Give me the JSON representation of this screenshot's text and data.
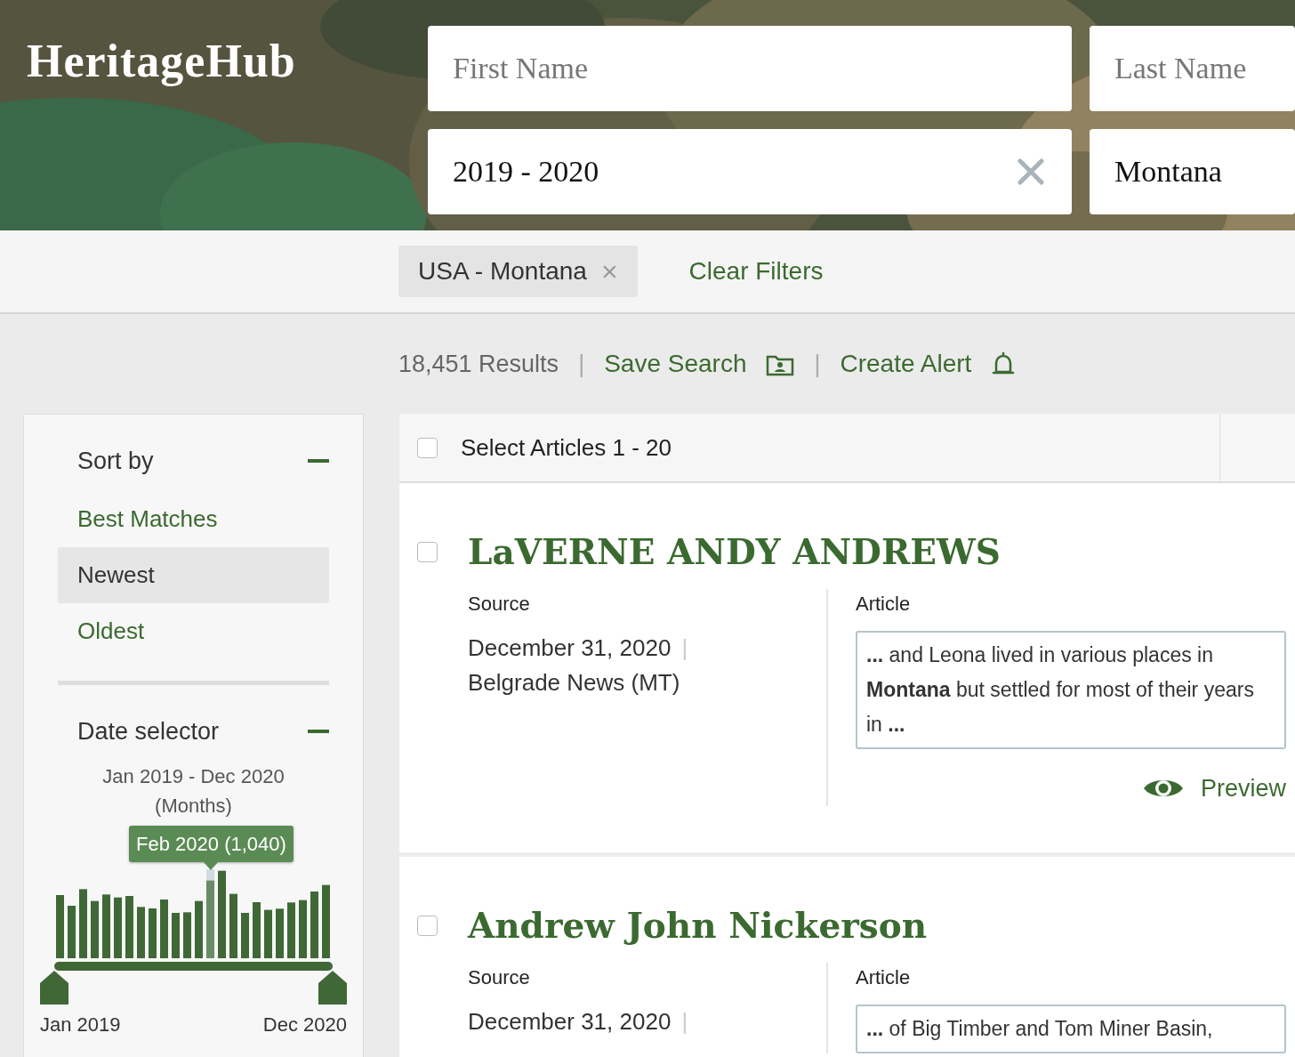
{
  "logo": "HeritageHub",
  "search_fields": [
    {
      "placeholder": "First Name"
    },
    {
      "placeholder": "Last Name"
    },
    {
      "value": "2019 - 2020",
      "clearable": true
    },
    {
      "value": "Montana",
      "clearable": false
    }
  ],
  "filters": {
    "chips": [
      {
        "label": "USA - Montana",
        "remove": "×"
      }
    ],
    "clear_link": "Clear Filters"
  },
  "results_bar": {
    "count": "18,451 Results",
    "separator": "|",
    "save_search": "Save Search",
    "create_alert": "Create Alert"
  },
  "sidebar": {
    "sort": {
      "title": "Sort by",
      "expanded": true,
      "options": [
        {
          "label": "Best Matches",
          "selected": false
        },
        {
          "label": "Newest",
          "selected": true
        },
        {
          "label": "Oldest",
          "selected": false
        }
      ]
    },
    "date_selector": {
      "title": "Date selector",
      "expanded": true,
      "range": "Jan 2019 - Dec 2020",
      "unit": "(Months)",
      "tooltip_label": "Feb 2020",
      "tooltip_count": "(1,040)",
      "handles": [
        {
          "level": 0
        },
        {
          "level": 1
        }
      ],
      "start_label": "Jan 2019",
      "end_label": "Dec 2020"
    }
  },
  "results": {
    "select_all": {
      "label": "Select Articles 1 - 20",
      "checked": false
    },
    "articles": [
      {
        "checked": false,
        "title": "LaVERNE ANDY ANDREWS",
        "source_label": "Source",
        "date": "December 31, 2020",
        "pipe": "|",
        "source": "Belgrade News (MT)",
        "article_label": "Article",
        "snippet": "**...** and Leona lived in various places in **Montana** but settled for most of their years in **...**",
        "preview": "Preview"
      },
      {
        "checked": false,
        "title": "Andrew John Nickerson",
        "source_label": "Source",
        "date": "December 31, 2020",
        "pipe": "|",
        "article_label": "Article",
        "snippet": "**...** of Big Timber and Tom Miner Basin,"
      }
    ]
  }
}
